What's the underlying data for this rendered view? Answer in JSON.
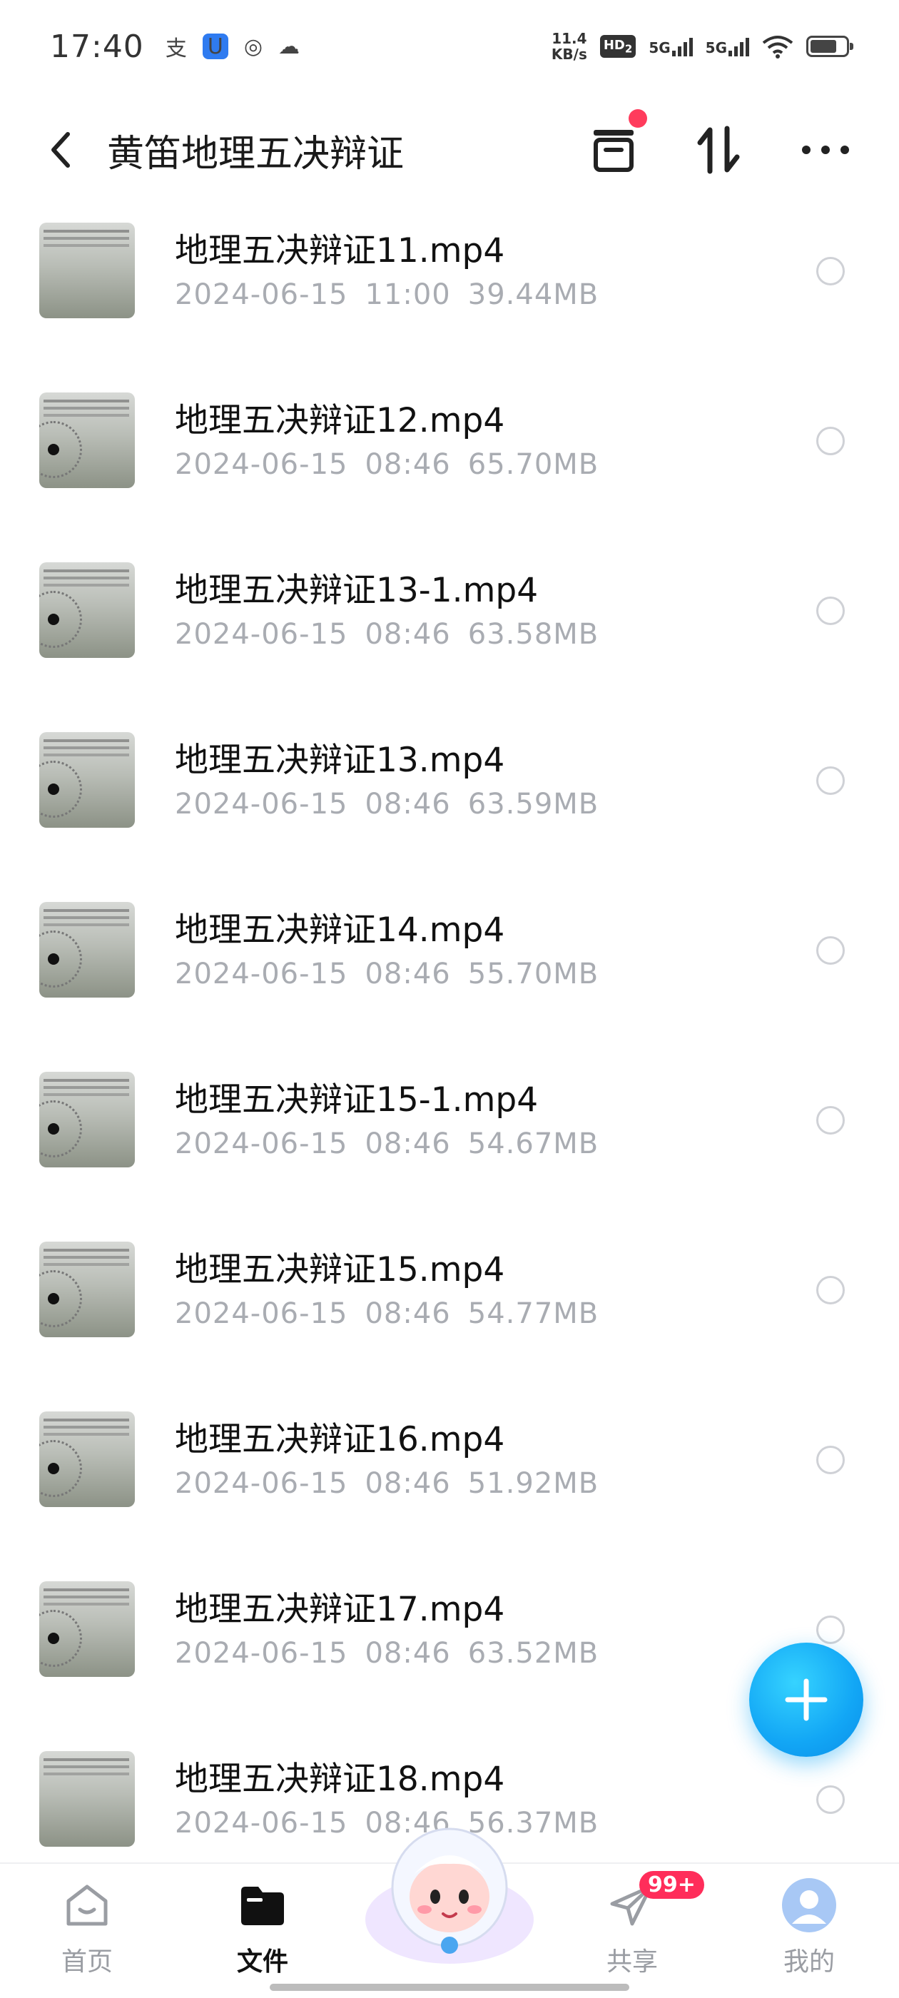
{
  "status_bar": {
    "time": "17:40",
    "net_speed_value": "11.4",
    "net_speed_unit": "KB/s",
    "hd_label": "HD",
    "hd_sub": "2",
    "signal1_label": "5G",
    "signal2_label": "5G",
    "icons": [
      "alipay-icon",
      "app-badge-icon",
      "planet-icon",
      "cloud-icon",
      "wifi-icon",
      "battery-icon"
    ]
  },
  "header": {
    "title": "黄笛地理五决辩证",
    "back_icon": "chevron-left-icon",
    "actions": [
      "archive-icon",
      "sort-icon",
      "more-icon"
    ]
  },
  "files": [
    {
      "name": "地理五决辩证11.mp4",
      "date": "2024-06-15",
      "time": "11:00",
      "size": "39.44MB"
    },
    {
      "name": "地理五决辩证12.mp4",
      "date": "2024-06-15",
      "time": "08:46",
      "size": "65.70MB"
    },
    {
      "name": "地理五决辩证13-1.mp4",
      "date": "2024-06-15",
      "time": "08:46",
      "size": "63.58MB"
    },
    {
      "name": "地理五决辩证13.mp4",
      "date": "2024-06-15",
      "time": "08:46",
      "size": "63.59MB"
    },
    {
      "name": "地理五决辩证14.mp4",
      "date": "2024-06-15",
      "time": "08:46",
      "size": "55.70MB"
    },
    {
      "name": "地理五决辩证15-1.mp4",
      "date": "2024-06-15",
      "time": "08:46",
      "size": "54.67MB"
    },
    {
      "name": "地理五决辩证15.mp4",
      "date": "2024-06-15",
      "time": "08:46",
      "size": "54.77MB"
    },
    {
      "name": "地理五决辩证16.mp4",
      "date": "2024-06-15",
      "time": "08:46",
      "size": "51.92MB"
    },
    {
      "name": "地理五决辩证17.mp4",
      "date": "2024-06-15",
      "time": "08:46",
      "size": "63.52MB"
    },
    {
      "name": "地理五决辩证18.mp4",
      "date": "2024-06-15",
      "time": "08:46",
      "size": "56.37MB"
    }
  ],
  "fab": {
    "icon": "plus-icon"
  },
  "tabbar": {
    "tabs": [
      {
        "label": "首页",
        "icon": "home-icon"
      },
      {
        "label": "文件",
        "icon": "folder-icon",
        "active": true
      },
      {
        "label": "",
        "icon": "mascot-icon"
      },
      {
        "label": "共享",
        "icon": "send-icon",
        "badge": "99+"
      },
      {
        "label": "我的",
        "icon": "profile-icon"
      }
    ]
  },
  "colors": {
    "accent": "#12a6f5",
    "badge": "#ff2d5a",
    "meta_text": "#a9acb2"
  }
}
